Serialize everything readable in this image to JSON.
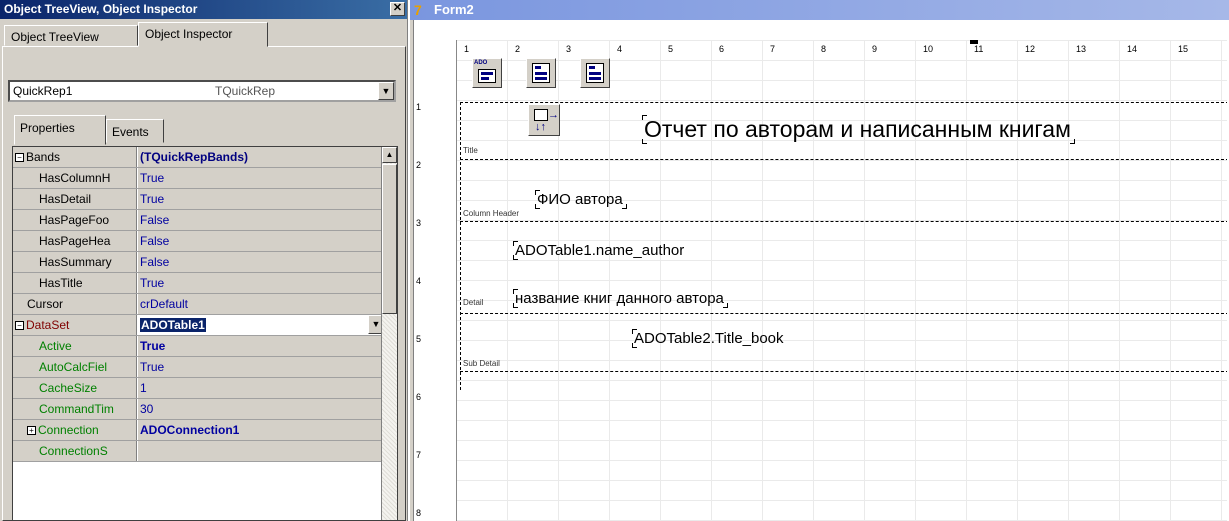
{
  "inspector": {
    "title": "Object TreeView, Object Inspector",
    "close_glyph": "✕",
    "tabs": [
      "Object TreeView",
      "Object Inspector"
    ],
    "component_name": "QuickRep1",
    "component_type": "TQuickRep",
    "subtabs": [
      "Properties",
      "Events"
    ],
    "properties": [
      {
        "name": "Bands",
        "value": "(TQuickRepBands)",
        "expander": "⊟",
        "indent": 0,
        "style": "bold"
      },
      {
        "name": "HasColumnH",
        "value": "True",
        "indent": 2
      },
      {
        "name": "HasDetail",
        "value": "True",
        "indent": 2
      },
      {
        "name": "HasPageFoo",
        "value": "False",
        "indent": 2
      },
      {
        "name": "HasPageHea",
        "value": "False",
        "indent": 2
      },
      {
        "name": "HasSummary",
        "value": "False",
        "indent": 2
      },
      {
        "name": "HasTitle",
        "value": "True",
        "indent": 2
      },
      {
        "name": "Cursor",
        "value": "crDefault",
        "indent": 1
      },
      {
        "name": "DataSet",
        "value": "ADOTable1",
        "expander": "⊟",
        "indent": 0,
        "style": "selected"
      },
      {
        "name": "Active",
        "value": "True",
        "indent": 2,
        "style": "green-bold"
      },
      {
        "name": "AutoCalcFiel",
        "value": "True",
        "indent": 2,
        "style": "green"
      },
      {
        "name": "CacheSize",
        "value": "1",
        "indent": 2,
        "style": "green"
      },
      {
        "name": "CommandTim",
        "value": "30",
        "indent": 2,
        "style": "green"
      },
      {
        "name": "Connection",
        "value": "ADOConnection1",
        "expander": "⊞",
        "indent": 1,
        "style": "green-bold"
      },
      {
        "name": "ConnectionS",
        "value": "",
        "indent": 2,
        "style": "green"
      }
    ]
  },
  "form": {
    "title": "Form2",
    "icon_glyph": "7",
    "ruler_top": [
      "1",
      "2",
      "3",
      "4",
      "5",
      "6",
      "7",
      "8",
      "9",
      "10",
      "11",
      "12",
      "13",
      "14",
      "15"
    ],
    "ruler_left": [
      "1",
      "2",
      "3",
      "4",
      "5",
      "6",
      "7",
      "8"
    ],
    "toolbar_icons": [
      "ADO",
      "ADO",
      "ADO"
    ],
    "bands": [
      {
        "label": "Title"
      },
      {
        "label": "Column Header"
      },
      {
        "label": ""
      },
      {
        "label": "Detail"
      },
      {
        "label": "Sub Detail"
      }
    ],
    "labels": {
      "report_title": "Отчет по авторам и написанным книгам",
      "author_header": "ФИО автора",
      "name_author": "ADOTable1.name_author",
      "books_header": "название книг данного автора",
      "title_book": "ADOTable2.Title_book"
    }
  }
}
